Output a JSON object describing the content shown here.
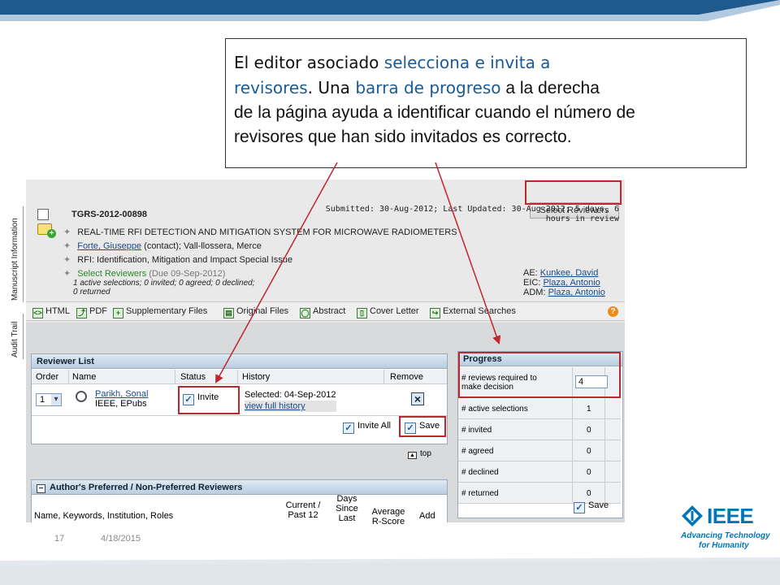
{
  "slide": {
    "number": "17",
    "date": "4/18/2015",
    "brand_color": "#1f5a8e",
    "accent_red": "#c0262d"
  },
  "callout": {
    "line1_a": "El editor asociado ",
    "line1_b": "selecciona e invita a",
    "line2_a": "revisores",
    "line2_b": ".  Una ",
    "line2_c": "barra de progreso",
    "line2_d": " a la derecha",
    "line3": "de la página ayuda a identificar cuando el número de",
    "line4": "revisores que han sido invitados es correcto."
  },
  "sidebar": {
    "tab_manuscript": "Manuscript Information",
    "tab_audit": "Audit Trail"
  },
  "manuscript": {
    "select_reviewers_btn": "Select Reviewers",
    "id": "TGRS-2012-00898",
    "submitted_line1": "Submitted: 30-Aug-2012; Last Updated: 30-Aug-2012; 5 days, 6",
    "submitted_line2": "hours in review",
    "title": "REAL-TIME RFI DETECTION AND MITIGATION SYSTEM FOR MICROWAVE RADIOMETERS",
    "author_link": "Forte, Giuseppe",
    "author_rest": " (contact); Vall-llossera, Merce",
    "rfi": "RFI: Identification, Mitigation and Impact Special Issue",
    "task_label": "Select Reviewers",
    "task_due": " (Due 09-Sep-2012)",
    "task_status1": "1 active selections; 0 invited; 0 agreed; 0 declined;",
    "task_status2": "0 returned",
    "ae_label": "AE: ",
    "ae_name": "Kunkee, David",
    "eic_label": "EIC: ",
    "eic_name": "Plaza, Antonio",
    "adm_label": "ADM: ",
    "adm_name": "Plaza, Antonio"
  },
  "toolbar": {
    "html": "HTML",
    "pdf": "PDF",
    "supplementary": "Supplementary Files",
    "original": "Original Files",
    "abstract": "Abstract",
    "cover": "Cover Letter",
    "external": "External Searches",
    "help": "?"
  },
  "reviewer_list": {
    "header": "Reviewer List",
    "columns": [
      "Order",
      "Name",
      "Status",
      "History",
      "Remove"
    ],
    "row": {
      "order": "1",
      "name": "Parikh, Sonal",
      "affiliation": "IEEE, EPubs",
      "status": "Invite",
      "history_selected": "Selected: 04-Sep-2012",
      "history_link": "view full history"
    },
    "invite_all": "Invite All",
    "save": "Save",
    "top": "top"
  },
  "preferred": {
    "header": "Author's Preferred / Non-Preferred Reviewers",
    "col_name": "Name, Keywords, Institution, Roles",
    "col_current_1": "Current /",
    "col_current_2": "Past 12",
    "col_days_1": "Days",
    "col_days_2": "Since",
    "col_days_3": "Last",
    "col_avg_1": "Average",
    "col_avg_2": "R-Score",
    "col_add": "Add"
  },
  "progress": {
    "header": "Progress",
    "rows": [
      {
        "label1": "# reviews required to",
        "label2": "make decision",
        "value": "4"
      },
      {
        "label1": "# active selections",
        "label2": "",
        "value": "1"
      },
      {
        "label1": "# invited",
        "label2": "",
        "value": "0"
      },
      {
        "label1": "# agreed",
        "label2": "",
        "value": "0"
      },
      {
        "label1": "# declined",
        "label2": "",
        "value": "0"
      },
      {
        "label1": "# returned",
        "label2": "",
        "value": "0"
      }
    ],
    "save": "Save"
  },
  "logo": {
    "word": "IEEE",
    "tagline1": "Advancing Technology",
    "tagline2": "for Humanity"
  }
}
